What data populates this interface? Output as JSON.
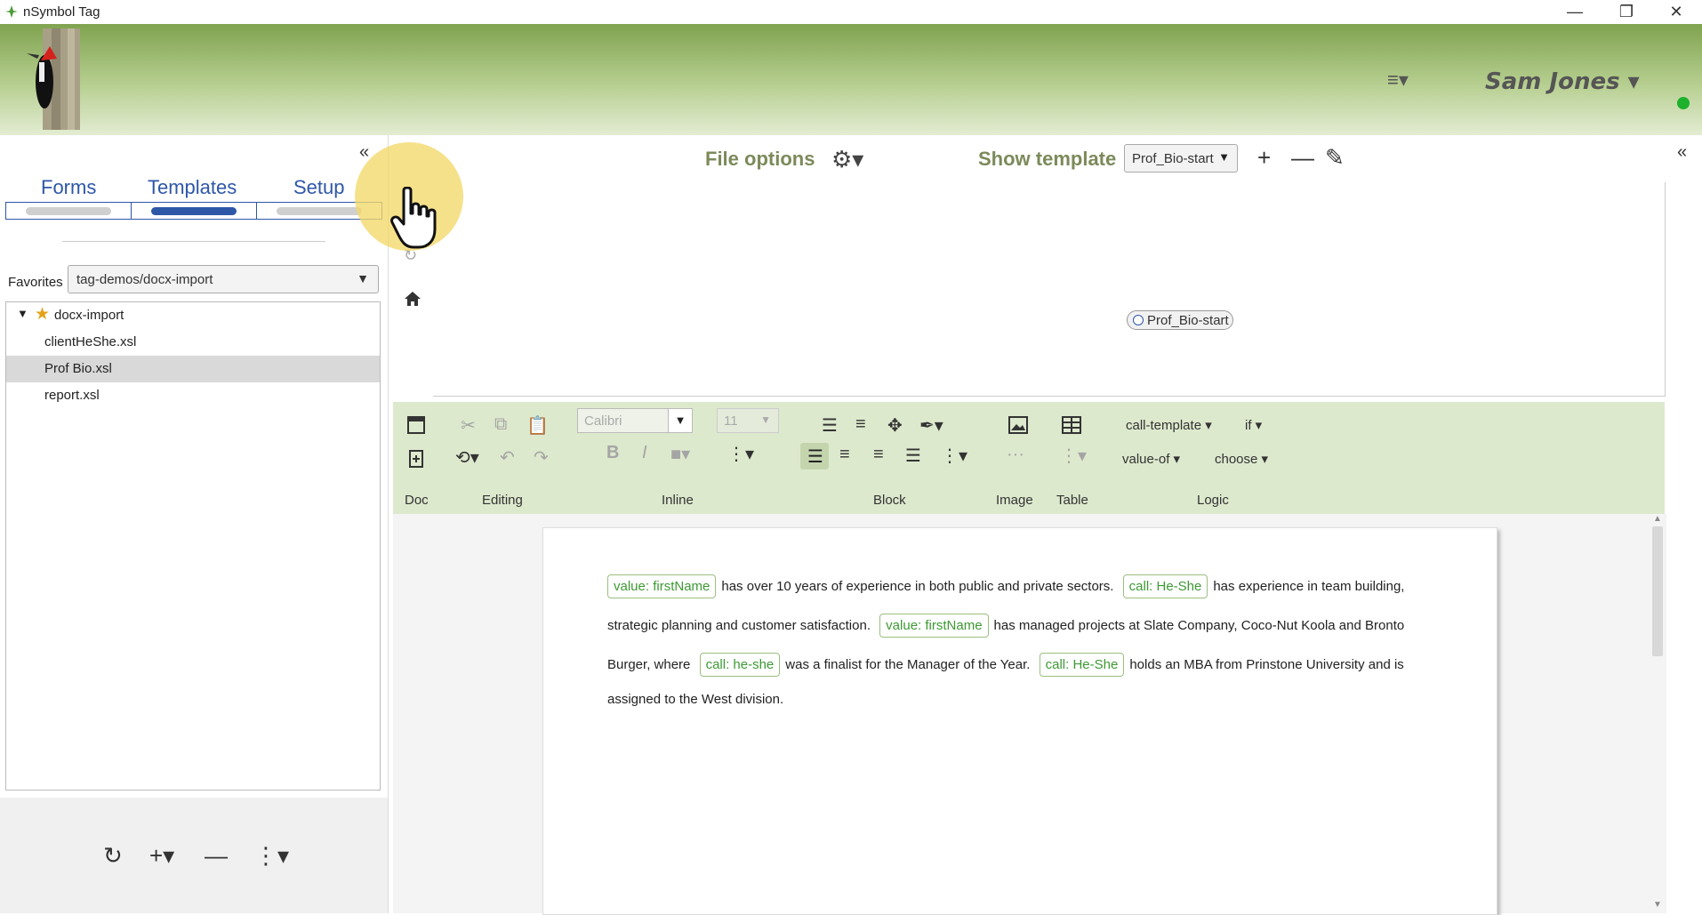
{
  "window": {
    "title": "nSymbol Tag",
    "minimize": "—",
    "restore": "❐",
    "close": "✕"
  },
  "header": {
    "menu_icon": "≡▾",
    "user": "Sam Jones ▾"
  },
  "left_panel": {
    "collapse": "«",
    "tabs": [
      {
        "label": "Forms"
      },
      {
        "label": "Templates"
      },
      {
        "label": "Setup"
      }
    ],
    "favorites_label": "Favorites",
    "favorites_value": "tag-demos/docx-import",
    "tree": {
      "folder": "docx-import",
      "files": [
        "clientHeShe.xsl",
        "Prof Bio.xsl",
        "report.xsl"
      ]
    },
    "footer": {
      "refresh": "↻",
      "add": "+▾",
      "remove": "—",
      "more": "⋮▾"
    }
  },
  "options_bar": {
    "file_options": "File options",
    "show_template": "Show template",
    "template_value": "Prof_Bio-start",
    "add": "+",
    "remove": "—",
    "edit": "✎"
  },
  "preview": {
    "node_label": "Prof_Bio-start"
  },
  "ribbon": {
    "font": "Calibri",
    "size": "11",
    "bold": "B",
    "italic": "I",
    "call_template": "call-template ▾",
    "if": "if ▾",
    "value_of": "value-of ▾",
    "choose": "choose ▾",
    "groups": [
      "Doc",
      "Editing",
      "Inline",
      "Block",
      "Image",
      "Table",
      "Logic"
    ]
  },
  "document": {
    "line1": {
      "chip1": "value: firstName",
      "text1": "has over 10 years of experience in both public and private sectors.",
      "chip2": "call: He-She",
      "text2": "has experience in team building,"
    },
    "line2": {
      "text1": "strategic planning and customer satisfaction.",
      "chip1": "value: firstName",
      "text2": "has managed projects at Slate Company, Coco-Nut Koola and Bronto"
    },
    "line3": {
      "text1": "Burger, where",
      "chip1": "call: he-she",
      "text2": "was a finalist for the Manager of the Year.",
      "chip2": "call: He-She",
      "text3": "holds an MBA from Prinstone University and is"
    },
    "line4": {
      "text1": "assigned to the West division."
    }
  },
  "colors": {
    "accent": "#2e57a8",
    "header_green": "#7fa34f",
    "ribbon": "#dde9cd",
    "chip_text": "#3c9a32",
    "status": "#1db12d"
  }
}
